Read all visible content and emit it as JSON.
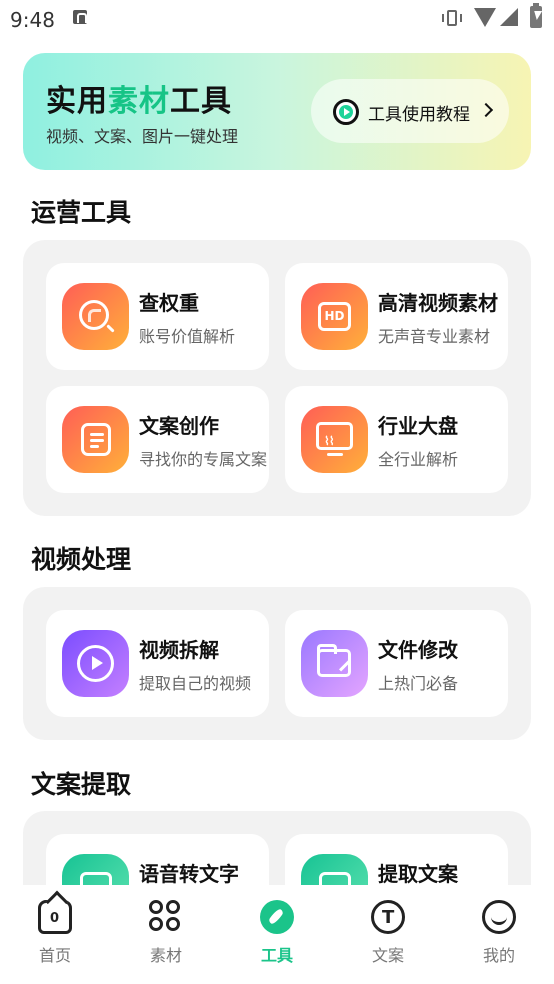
{
  "status_bar": {
    "time": "9:48"
  },
  "banner": {
    "title_pre": "实用",
    "title_highlight": "素材",
    "title_post": "工具",
    "subtitle": "视频、文案、图片一键处理",
    "tutorial_label": "工具使用教程"
  },
  "sections": [
    {
      "title": "运营工具",
      "cards": [
        {
          "name": "查权重",
          "desc": "账号价值解析",
          "icon": "search-icon"
        },
        {
          "name": "高清视频素材",
          "desc": "无声音专业素材",
          "icon": "hd-icon"
        },
        {
          "name": "文案创作",
          "desc": "寻找你的专属文案",
          "icon": "document-icon"
        },
        {
          "name": "行业大盘",
          "desc": "全行业解析",
          "icon": "monitor-chart-icon"
        }
      ]
    },
    {
      "title": "视频处理",
      "cards": [
        {
          "name": "视频拆解",
          "desc": "提取自己的视频",
          "icon": "play-icon"
        },
        {
          "name": "文件修改",
          "desc": "上热门必备",
          "icon": "folder-edit-icon"
        }
      ]
    },
    {
      "title": "文案提取",
      "cards": [
        {
          "name": "语音转文字",
          "desc": "",
          "icon": "audio-text-icon"
        },
        {
          "name": "提取文案",
          "desc": "",
          "icon": "video-text-icon"
        }
      ]
    }
  ],
  "nav": {
    "home_glyph": "0",
    "text_glyph": "T",
    "items": [
      {
        "label": "首页",
        "icon": "home-icon"
      },
      {
        "label": "素材",
        "icon": "grid-icon"
      },
      {
        "label": "工具",
        "icon": "compass-icon",
        "active": true
      },
      {
        "label": "文案",
        "icon": "text-circle-icon"
      },
      {
        "label": "我的",
        "icon": "smile-icon"
      }
    ]
  },
  "colors": {
    "accent": "#1bc48a",
    "orange_start": "#ff5e56",
    "orange_end": "#ffb03a",
    "purple": "#7b4dff"
  }
}
